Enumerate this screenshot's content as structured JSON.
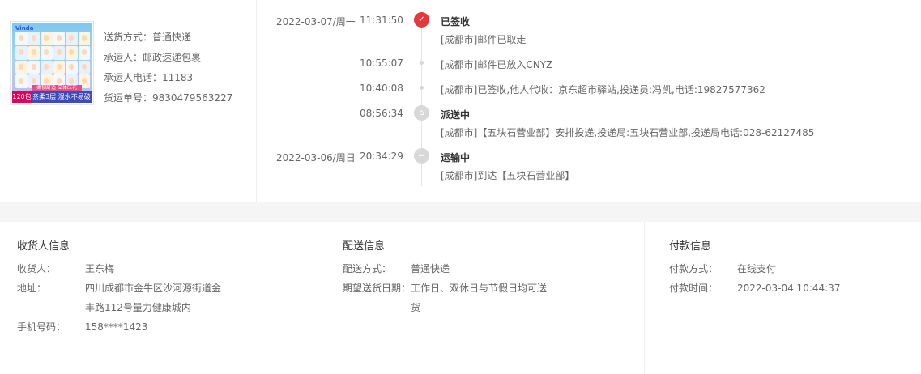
{
  "product": {
    "image_alt": "纸巾产品图",
    "badge": "120包",
    "strip_top": "柔韧舒适 立体压花",
    "strip_text": "亲柔3层 湿水不易破",
    "brand": "Vinda"
  },
  "shipping": {
    "method": "送货方式：普通快递",
    "carrier": "承运人：邮政速递包裹",
    "phone": "承运人电话：11183",
    "waybill": "货运单号：9830479563227"
  },
  "timeline": [
    {
      "date": "2022-03-07/周一",
      "time": "11:31:50",
      "status": "已签收",
      "desc": "[成都市]邮件已取走",
      "icon": "check-icon"
    },
    {
      "date": "",
      "time": "10:55:07",
      "status": "",
      "desc": "[成都市]邮件已放入CNYZ",
      "icon": "dot-icon"
    },
    {
      "date": "",
      "time": "10:40:08",
      "status": "",
      "desc": "[成都市]已签收,他人代收：京东超市驿站,投递员:冯凯,电话:19827577362",
      "icon": "dot-icon"
    },
    {
      "date": "",
      "time": "08:56:34",
      "status": "派送中",
      "desc": "[成都市]【五块石营业部】安排投递,投递局:五块石营业部,投递局电话:028-62127485",
      "icon": "delivery-icon"
    },
    {
      "date": "2022-03-06/周日",
      "time": "20:34:29",
      "status": "运输中",
      "desc": "[成都市]到达【五块石营业部】",
      "icon": "truck-icon"
    }
  ],
  "receiver": {
    "title": "收货人信息",
    "name_label": "收货人：",
    "name": "王东梅",
    "address_label": "地址：",
    "address_line1": "四川成都市金牛区沙河源街道金",
    "address_line2": "丰路112号量力健康城内",
    "phone_label": "手机号码：",
    "phone": "158****1423"
  },
  "delivery": {
    "title": "配送信息",
    "method_label": "配送方式：",
    "method": "普通快递",
    "date_label": "期望送货日期：",
    "date_line1": "工作日、双休日与节假日均可送",
    "date_line2": "货"
  },
  "payment": {
    "title": "付款信息",
    "method_label": "付款方式：",
    "method": "在线支付",
    "time_label": "付款时间：",
    "time": "2022-03-04 10:44:37"
  },
  "colors": {
    "accent": "#e4393c",
    "band": "#f5f5f5",
    "node_gray": "#d8d8d8"
  }
}
